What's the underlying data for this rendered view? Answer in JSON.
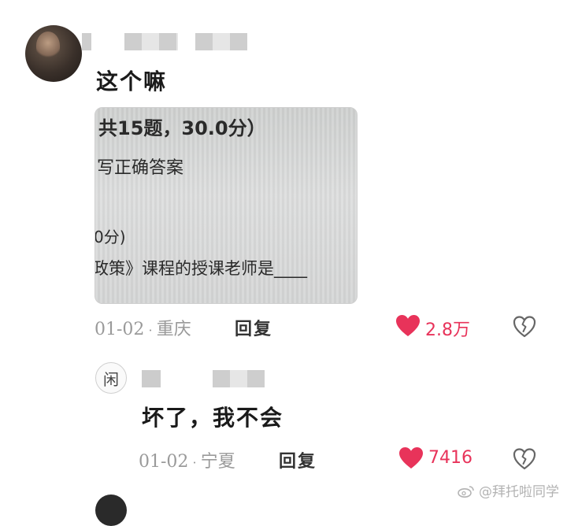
{
  "comment": {
    "text": "这个嘛",
    "photo_lines": [
      "共15题，30.0分）",
      "写正确答案",
      "0分)",
      "政策》课程的授课老师是____"
    ],
    "date": "01-02",
    "location": "重庆",
    "reply_label": "回复",
    "likes": "2.8万"
  },
  "reply": {
    "avatar_char": "闲",
    "text": "坏了，我不会",
    "date": "01-02",
    "location": "宁夏",
    "reply_label": "回复",
    "likes": "7416"
  },
  "watermark": "@拜托啦同学",
  "colors": {
    "like": "#e8335a",
    "meta": "#9a9a9a"
  },
  "icons": [
    "heart-icon",
    "broken-heart-icon",
    "weibo-icon"
  ]
}
